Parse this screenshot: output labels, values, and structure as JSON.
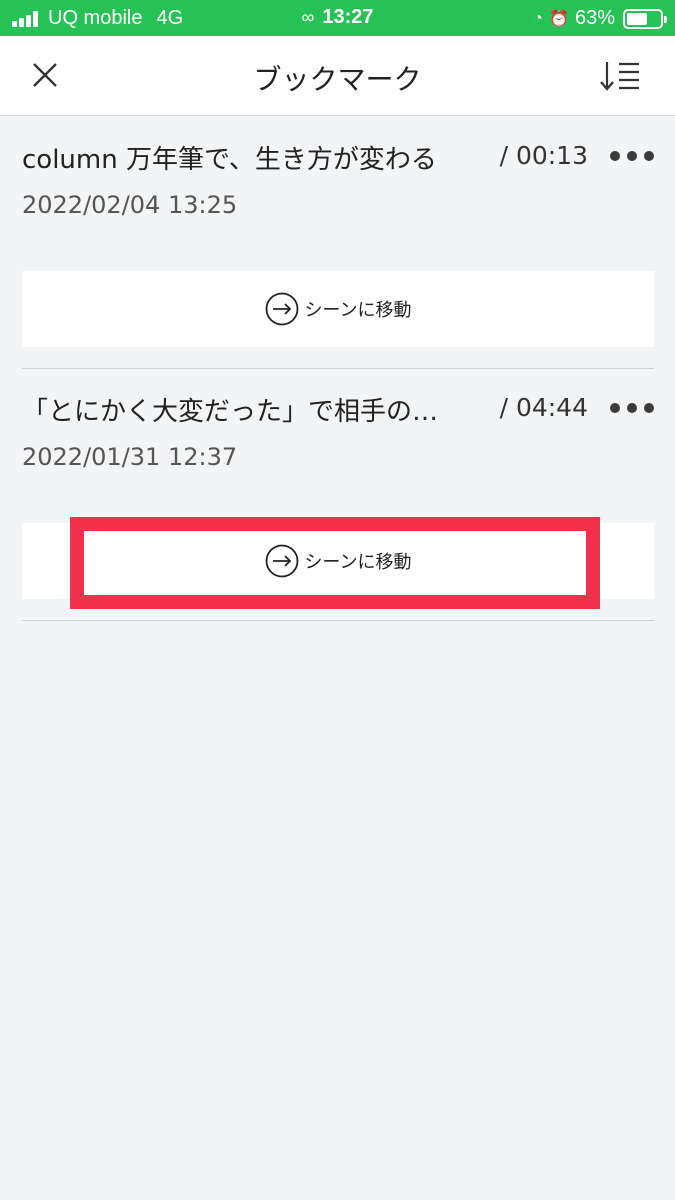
{
  "status_bar": {
    "carrier": "UQ mobile",
    "network": "4G",
    "time": "13:27",
    "battery": "63%",
    "battery_level": 0.63,
    "color": "#27c255"
  },
  "header": {
    "title": "ブックマーク",
    "close_icon": "close-icon",
    "sort_icon": "sort-icon"
  },
  "bookmarks": [
    {
      "title": "column 万年筆で、生き方が変わる",
      "time": "/ 00:13",
      "date": "2022/02/04 13:25",
      "button_label": "シーンに移動"
    },
    {
      "title": "「とにかく大変だった」で相手の…",
      "time": "/ 04:44",
      "date": "2022/01/31 12:37",
      "button_label": "シーンに移動"
    }
  ],
  "highlight_color": "#f4304a"
}
